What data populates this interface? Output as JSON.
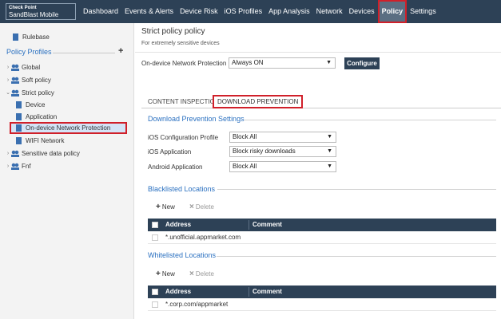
{
  "logo": {
    "line1": "Check Point",
    "line2": "SandBlast Mobile"
  },
  "nav": [
    {
      "label": "Dashboard"
    },
    {
      "label": "Events & Alerts"
    },
    {
      "label": "Device Risk"
    },
    {
      "label": "iOS Profiles"
    },
    {
      "label": "App Analysis"
    },
    {
      "label": "Network"
    },
    {
      "label": "Devices"
    },
    {
      "label": "Policy",
      "active": true
    },
    {
      "label": "Settings"
    }
  ],
  "sidebar": {
    "rulebase": "Rulebase",
    "profiles_header": "Policy Profiles",
    "add_symbol": "+",
    "items": [
      {
        "label": "Global"
      },
      {
        "label": "Soft policy"
      },
      {
        "label": "Strict policy"
      },
      {
        "label": "Device"
      },
      {
        "label": "Application"
      },
      {
        "label": "On-device Network Protection"
      },
      {
        "label": "WIFI Network"
      },
      {
        "label": "Sensitive data policy"
      },
      {
        "label": "Fnf"
      }
    ]
  },
  "main": {
    "title": "Strict policy policy",
    "subtitle": "For extremely sensitive devices",
    "protection_label": "On-device Network Protection",
    "protection_value": "Always ON",
    "configure_label": "Configure",
    "tabs": [
      {
        "label": "CONTENT INSPECTION"
      },
      {
        "label": "DOWNLOAD PREVENTION",
        "active": true
      }
    ],
    "settings_title": "Download Prevention Settings",
    "settings": [
      {
        "label": "iOS Configuration Profile",
        "value": "Block All"
      },
      {
        "label": "iOS Application",
        "value": "Block risky downloads"
      },
      {
        "label": "Android Application",
        "value": "Block All"
      }
    ],
    "blacklist": {
      "title": "Blacklisted Locations",
      "new_label": "New",
      "delete_label": "Delete",
      "col_address": "Address",
      "col_comment": "Comment",
      "rows": [
        {
          "address": "*.unofficial.appmarket.com"
        }
      ]
    },
    "whitelist": {
      "title": "Whitelisted Locations",
      "new_label": "New",
      "delete_label": "Delete",
      "col_address": "Address",
      "col_comment": "Comment",
      "rows": [
        {
          "address": "*.corp.com/appmarket"
        }
      ]
    }
  },
  "colors": {
    "nav_bg": "#2d4156",
    "accent_blue": "#2a70c0",
    "highlight_red": "#d0202a",
    "selected_bg": "#d4e4f7"
  }
}
